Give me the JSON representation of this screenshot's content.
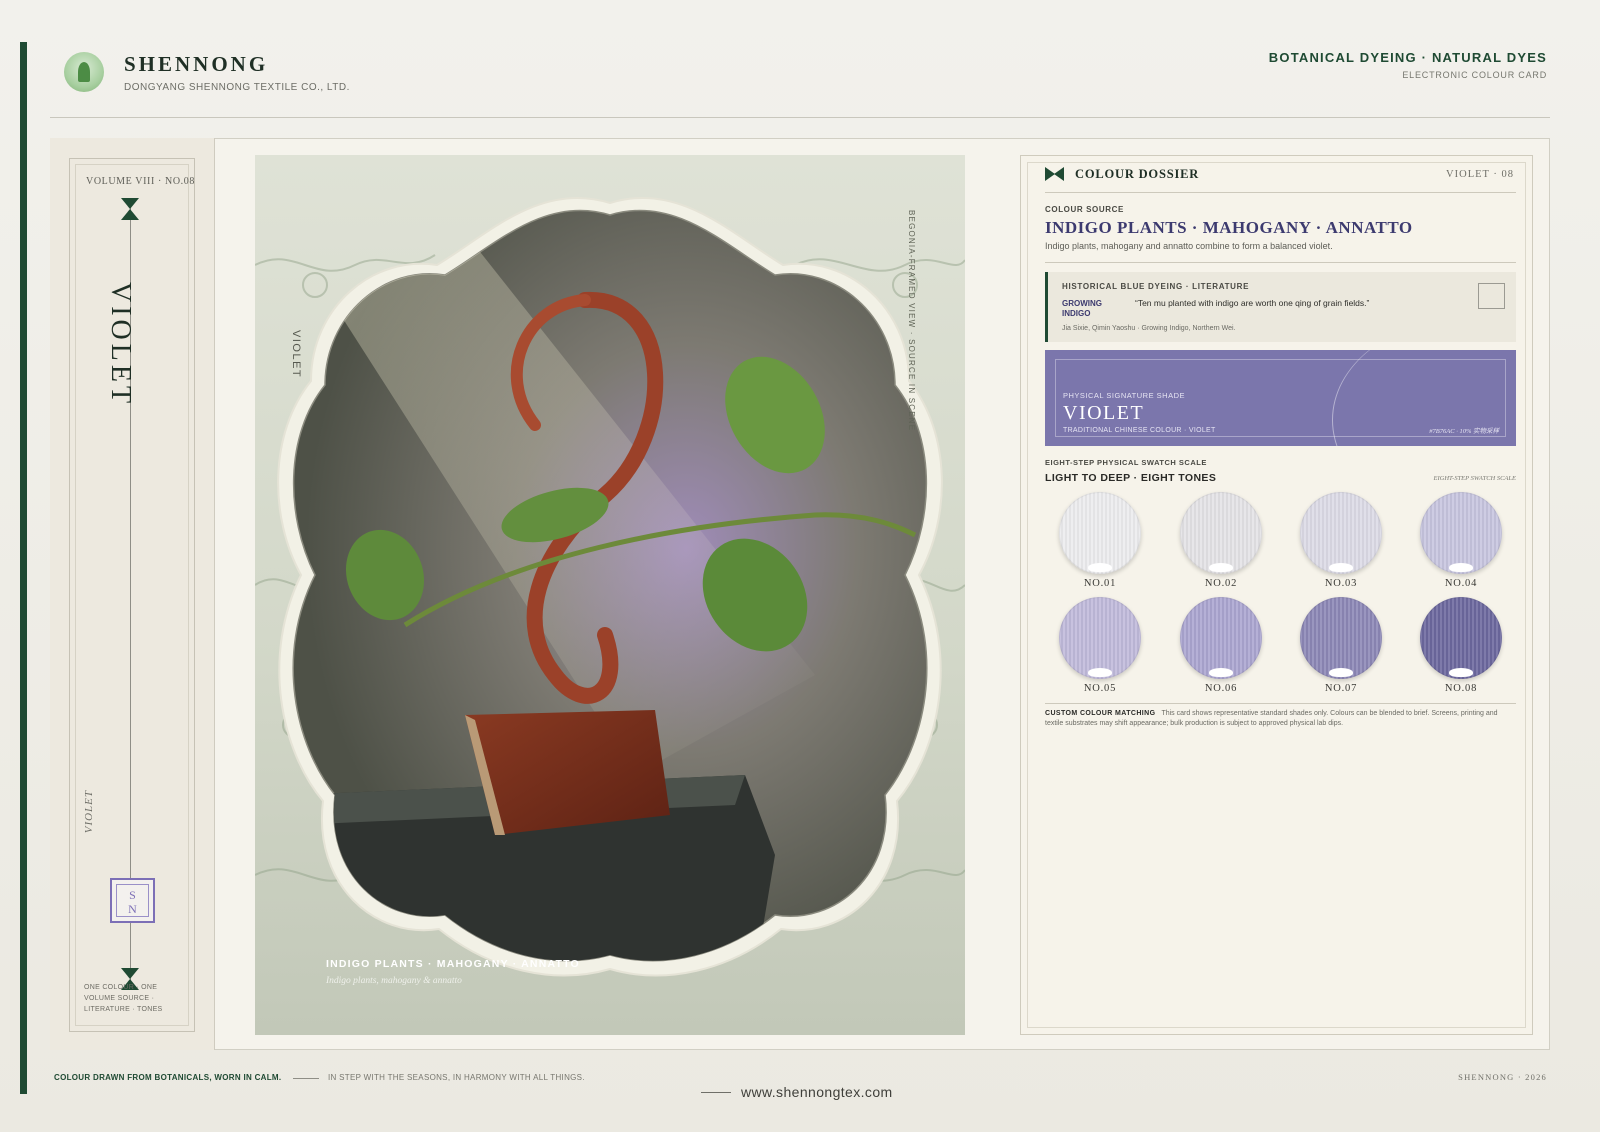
{
  "header": {
    "brand_name": "SHENNONG",
    "brand_sub": "DONGYANG SHENNONG TEXTILE CO., LTD.",
    "right_title": "BOTANICAL DYEING · NATURAL DYES",
    "right_sub": "ELECTRONIC COLOUR CARD"
  },
  "rail": {
    "volume": "VOLUME VIII · NO.08",
    "title": "VIOLET",
    "italic_label": "VIOLET",
    "seal_top": "S",
    "seal_bottom": "N",
    "footer": "ONE COLOUR · ONE VOLUME SOURCE · LITERATURE · TONES"
  },
  "image": {
    "side_label": "VIOLET",
    "right_label": "BEGONIA-FRAMED VIEW · SOURCE IN SCENE",
    "caption": "INDIGO PLANTS · MAHOGANY · ANNATTO",
    "caption_italic": "Indigo plants, mahogany & annatto"
  },
  "dossier": {
    "title": "COLOUR DOSSIER",
    "tag": "VIOLET · 08",
    "source_label": "COLOUR SOURCE",
    "source_title": "INDIGO PLANTS · MAHOGANY · ANNATTO",
    "source_desc": "Indigo plants, mahogany and annatto combine to form a balanced violet.",
    "literature": {
      "heading": "HISTORICAL BLUE DYEING · LITERATURE",
      "term": "GROWING INDIGO",
      "quote": "“Ten mu planted with indigo are worth one qing of grain fields.”",
      "citation": "Jia Sixie, Qimin Yaoshu · Growing Indigo, Northern Wei."
    },
    "signature": {
      "label": "PHYSICAL SIGNATURE SHADE",
      "name": "VIOLET",
      "sub": "TRADITIONAL CHINESE COLOUR · VIOLET",
      "code": "#7B76AC · 10% 实物采样",
      "color": "#7b76ac"
    },
    "scale": {
      "label": "EIGHT-STEP PHYSICAL SWATCH SCALE",
      "title": "LIGHT TO DEEP · EIGHT TONES",
      "note": "EIGHT-STEP SWATCH SCALE",
      "swatches": [
        {
          "label": "NO.01",
          "color": "#ececee"
        },
        {
          "label": "NO.02",
          "color": "#e4e3e6"
        },
        {
          "label": "NO.03",
          "color": "#dcdbe6"
        },
        {
          "label": "NO.04",
          "color": "#c7c5df"
        },
        {
          "label": "NO.05",
          "color": "#c0badb"
        },
        {
          "label": "NO.06",
          "color": "#aba5d0"
        },
        {
          "label": "NO.07",
          "color": "#8c87b6"
        },
        {
          "label": "NO.08",
          "color": "#6c689e"
        }
      ]
    },
    "custom": {
      "label": "CUSTOM COLOUR MATCHING",
      "text": "This card shows representative standard shades only. Colours can be blended to brief. Screens, printing and textile substrates may shift appearance; bulk production is subject to approved physical lab dips."
    }
  },
  "footer": {
    "left": "COLOUR DRAWN FROM BOTANICALS, WORN IN CALM.",
    "mid": "IN STEP WITH THE SEASONS, IN HARMONY WITH ALL THINGS.",
    "url": "www.shennongtex.com",
    "right": "SHENNONG · 2026"
  },
  "colors": {
    "brand_green": "#1f4a33",
    "accent_violet": "#3c3a6f"
  }
}
